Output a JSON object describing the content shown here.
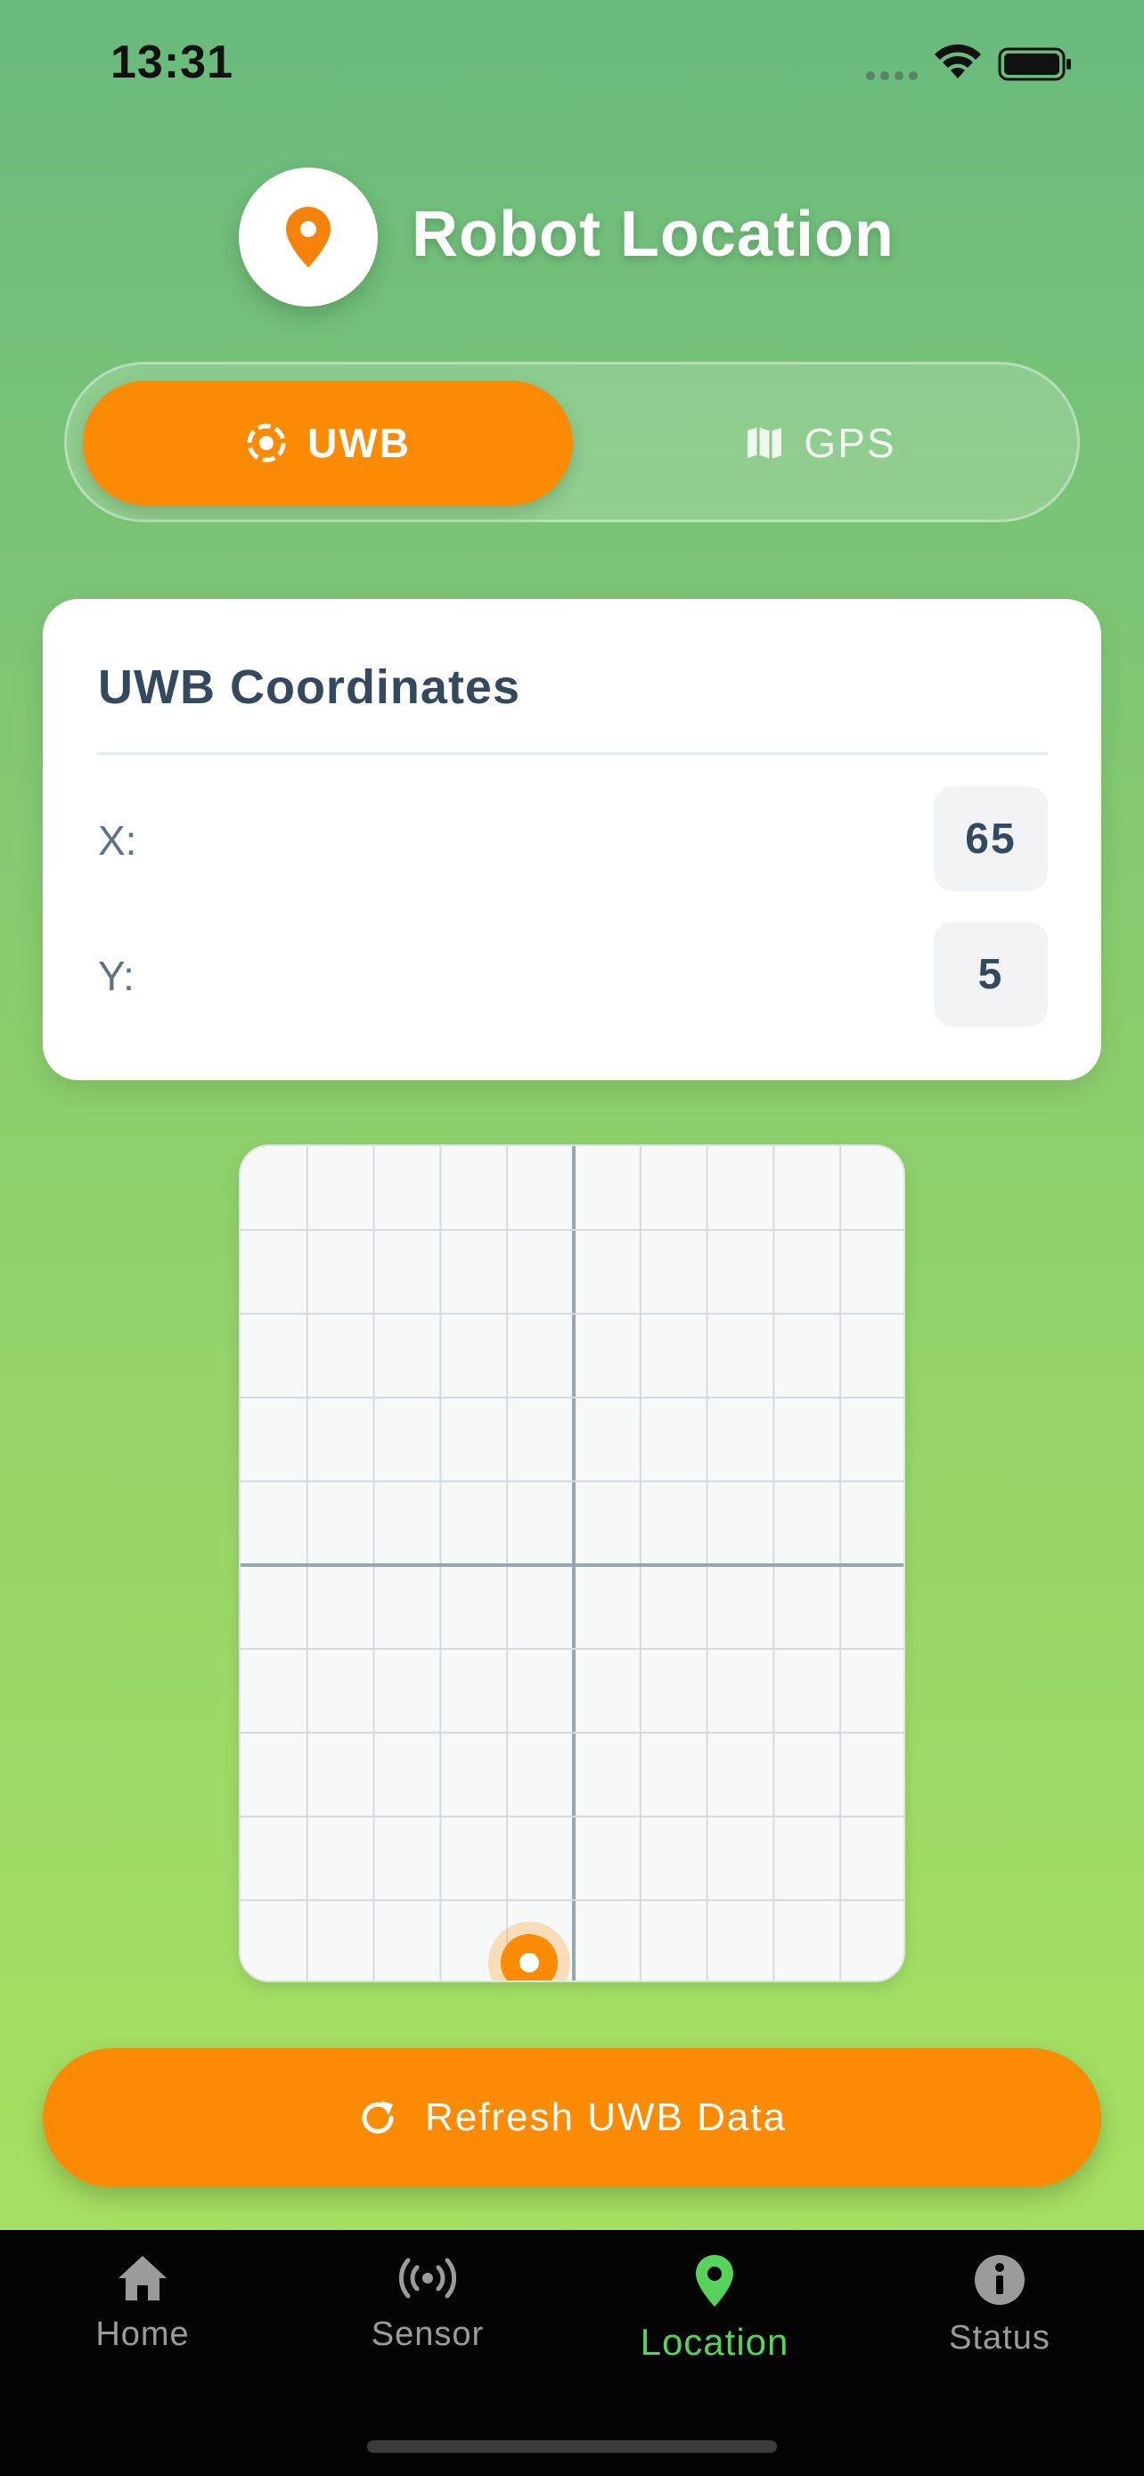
{
  "status_bar": {
    "time": "13:31",
    "icons": [
      "cellular-signal-icon",
      "wifi-icon",
      "battery-icon"
    ]
  },
  "header": {
    "title": "Robot Location",
    "icon": "location-pin-icon"
  },
  "mode_toggle": {
    "tabs": [
      {
        "label": "UWB",
        "icon": "uwb-target-icon",
        "selected": true
      },
      {
        "label": "GPS",
        "icon": "map-icon",
        "selected": false
      }
    ]
  },
  "coordinates_card": {
    "title": "UWB Coordinates",
    "x_label": "X:",
    "x_value": "65",
    "y_label": "Y:",
    "y_value": "5"
  },
  "map": {
    "robot_marker_icon": "robot-position-marker-icon"
  },
  "refresh_button": {
    "label": "Refresh UWB Data",
    "icon": "refresh-icon"
  },
  "bottom_nav": {
    "items": [
      {
        "label": "Home",
        "icon": "home-icon",
        "active": false
      },
      {
        "label": "Sensor",
        "icon": "broadcast-sensor-icon",
        "active": false
      },
      {
        "label": "Location",
        "icon": "location-pin-icon",
        "active": true
      },
      {
        "label": "Status",
        "icon": "info-icon",
        "active": false
      }
    ]
  },
  "colors": {
    "accent": "#fb8a05",
    "active_nav": "#57d35c",
    "background_top": "#69ba7e",
    "background_bottom": "#a9e25f"
  }
}
